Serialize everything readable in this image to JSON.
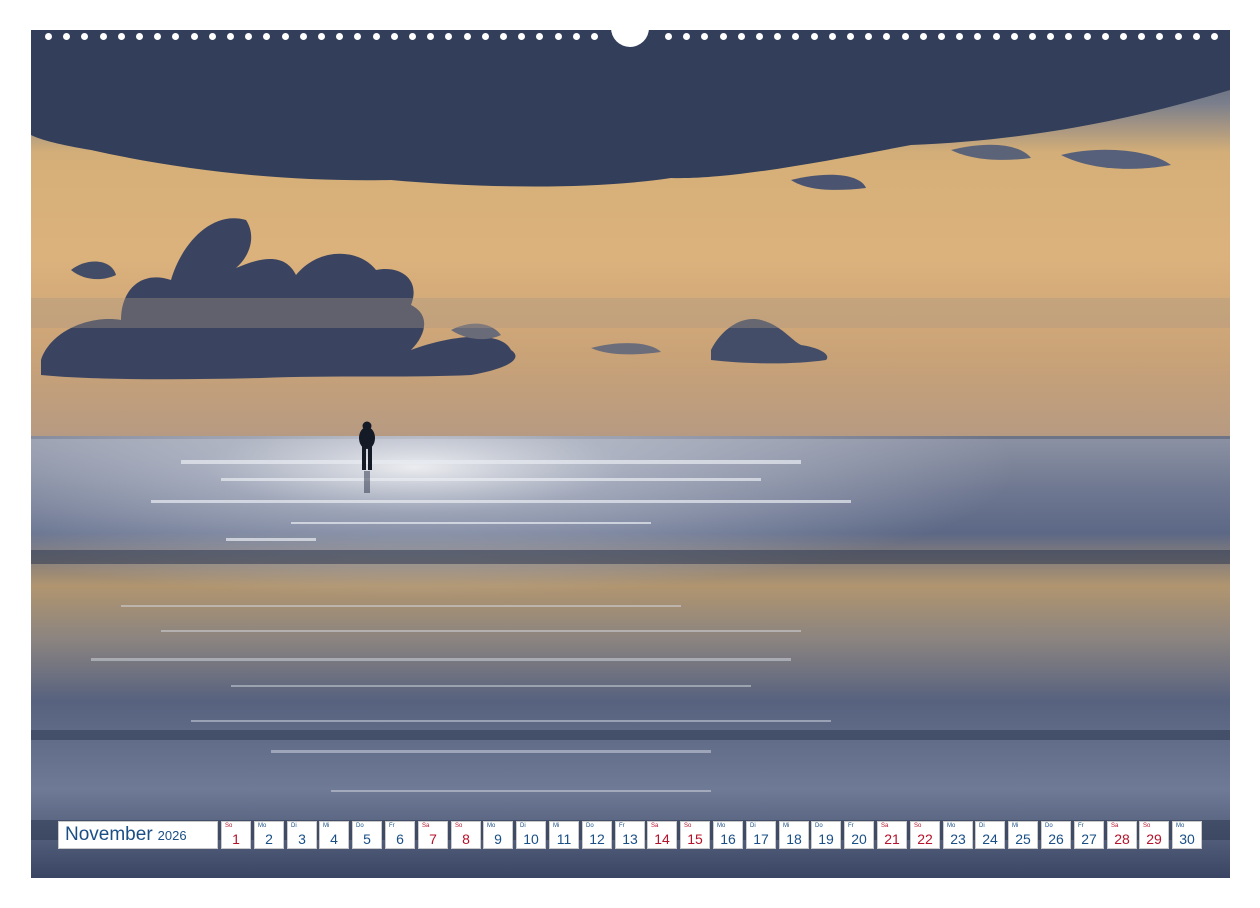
{
  "calendar": {
    "month": "November",
    "year": "2026",
    "days": [
      {
        "abbr": "So",
        "num": "1",
        "weekend": true
      },
      {
        "abbr": "Mo",
        "num": "2",
        "weekend": false
      },
      {
        "abbr": "Di",
        "num": "3",
        "weekend": false
      },
      {
        "abbr": "Mi",
        "num": "4",
        "weekend": false
      },
      {
        "abbr": "Do",
        "num": "5",
        "weekend": false
      },
      {
        "abbr": "Fr",
        "num": "6",
        "weekend": false
      },
      {
        "abbr": "Sa",
        "num": "7",
        "weekend": true
      },
      {
        "abbr": "So",
        "num": "8",
        "weekend": true
      },
      {
        "abbr": "Mo",
        "num": "9",
        "weekend": false
      },
      {
        "abbr": "Di",
        "num": "10",
        "weekend": false
      },
      {
        "abbr": "Mi",
        "num": "11",
        "weekend": false
      },
      {
        "abbr": "Do",
        "num": "12",
        "weekend": false
      },
      {
        "abbr": "Fr",
        "num": "13",
        "weekend": false
      },
      {
        "abbr": "Sa",
        "num": "14",
        "weekend": true
      },
      {
        "abbr": "So",
        "num": "15",
        "weekend": true
      },
      {
        "abbr": "Mo",
        "num": "16",
        "weekend": false
      },
      {
        "abbr": "Di",
        "num": "17",
        "weekend": false
      },
      {
        "abbr": "Mi",
        "num": "18",
        "weekend": false
      },
      {
        "abbr": "Do",
        "num": "19",
        "weekend": false
      },
      {
        "abbr": "Fr",
        "num": "20",
        "weekend": false
      },
      {
        "abbr": "Sa",
        "num": "21",
        "weekend": true
      },
      {
        "abbr": "So",
        "num": "22",
        "weekend": true
      },
      {
        "abbr": "Mo",
        "num": "23",
        "weekend": false
      },
      {
        "abbr": "Di",
        "num": "24",
        "weekend": false
      },
      {
        "abbr": "Mi",
        "num": "25",
        "weekend": false
      },
      {
        "abbr": "Do",
        "num": "26",
        "weekend": false
      },
      {
        "abbr": "Fr",
        "num": "27",
        "weekend": false
      },
      {
        "abbr": "Sa",
        "num": "28",
        "weekend": true
      },
      {
        "abbr": "So",
        "num": "29",
        "weekend": true
      },
      {
        "abbr": "Mo",
        "num": "30",
        "weekend": false
      }
    ]
  },
  "colors": {
    "text": "#1a4f86",
    "weekend": "#b4122a"
  }
}
